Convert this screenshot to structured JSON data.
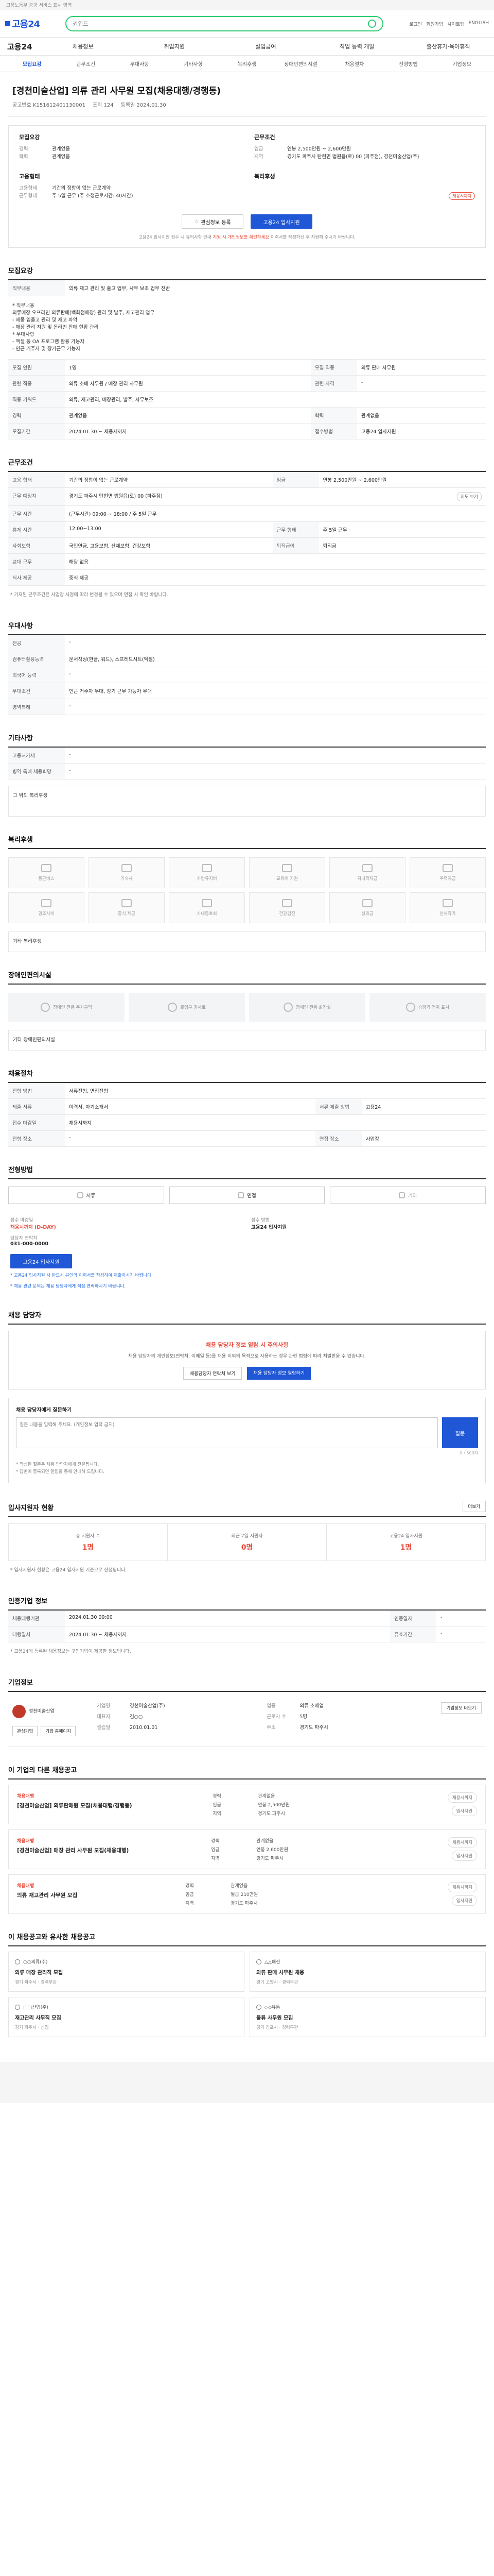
{
  "topbar": {
    "text": "고용노동부 공공 서비스 표시 영역"
  },
  "header": {
    "logo": "고용24",
    "search_placeholder": "키워드",
    "links": [
      "로그인",
      "회원가입",
      "사이트맵",
      "ENGLISH"
    ]
  },
  "nav": {
    "brand": "고용24",
    "items": [
      "채용정보",
      "취업지원",
      "실업급여",
      "직업 능력 개발",
      "출산휴가·육아휴직"
    ]
  },
  "tabs": {
    "items": [
      "모집요강",
      "근무조건",
      "우대사항",
      "기타사항",
      "복리후생",
      "장애인편의시설",
      "채용절차",
      "전형방법",
      "기업정보"
    ],
    "active": 0
  },
  "job": {
    "title": "[경천미술산업] 의류 관리 사무원 모집(채용대행/경행동)",
    "meta": [
      "공고번호 K151612401130001",
      "조회 124",
      "등록일 2024.01.30"
    ],
    "summary": {
      "left_title": "모집요강",
      "left": [
        {
          "k": "경력",
          "v": "관계없음"
        },
        {
          "k": "학력",
          "v": "관계없음"
        }
      ],
      "right_title": "근무조건",
      "right": [
        {
          "k": "임금",
          "v": "연봉 2,500만원 ~ 2,600만원"
        },
        {
          "k": "지역",
          "v": "경기도 파주시 탄현면 법원읍(로) 00 (파주점), 경천미술산업(주)"
        }
      ],
      "left2_title": "고용형태",
      "left2": [
        {
          "k": "고용형태",
          "v": "기간의 정함이 없는 근로계약"
        },
        {
          "k": "근무형태",
          "v": "주 5일 근무 (주 소정근로시간: 40시간)"
        }
      ],
      "right2_title": "복리후생",
      "right2": [],
      "deadline_badge": "채용시까지"
    },
    "buttons": {
      "save": "관심정보 등록",
      "apply": "고용24 입사지원"
    },
    "apply_notice_pre": "고용24 입사지원 접수 시 유의사항 안내",
    "apply_notice_red": "지원 시 개인정보를 확인하세요",
    "apply_notice_post": "이력서를 작성하신 후 지원해 주시기 바랍니다."
  },
  "recruit": {
    "title": "모집요강",
    "rows": [
      {
        "k": "직무내용",
        "v": "의류 재고 관리 및 출고 업무, 사무 보조 업무 전반"
      }
    ],
    "desc": [
      "* 직무내용",
      "의류매장 오프라인 의류판매(백화점매장) 관리 및 발주, 재고관리 업무",
      "- 제품 입출고 관리 및 재고 파악",
      "- 매장 관리 지원 및 온라인 판매 현황 관리",
      "* 우대사항",
      "- 엑셀 등 OA 프로그램 활용 가능자",
      "- 인근 거주자 및 장기근무 가능자"
    ],
    "table": [
      {
        "k1": "모집 인원",
        "v1": "1명",
        "k2": "모집 직종",
        "v2": "의류 판매 사무원"
      },
      {
        "k1": "관련 직종",
        "v1": "의류 소매 사무원 / 매장 관리 사무원",
        "k2": "관련 자격",
        "v2": "-"
      },
      {
        "k1": "직종 키워드",
        "v1": "의류, 재고관리, 매장관리, 발주, 사무보조",
        "k2": "",
        "v2": ""
      },
      {
        "k1": "경력",
        "v1": "관계없음",
        "k2": "학력",
        "v2": "관계없음"
      },
      {
        "k1": "모집기간",
        "v1": "2024.01.30 ~ 채용시까지",
        "k2": "접수방법",
        "v2": "고용24 입사지원"
      }
    ]
  },
  "condition": {
    "title": "근무조건",
    "rows": [
      {
        "k": "고용 형태",
        "v": "기간의 정함이 없는 근로계약",
        "k2": "임금",
        "v2": "연봉 2,500만원 ~ 2,600만원"
      },
      {
        "k": "근무 예정지",
        "v": "경기도 파주시 탄현면 법원읍(로) 00 (파주점)",
        "k2": "",
        "v2": ""
      },
      {
        "k": "근무 시간",
        "v": "(근무시간) 09:00 ~ 18:00 / 주 5일 근무",
        "k2": "",
        "v2": ""
      },
      {
        "k": "휴게 시간",
        "v": "12:00~13:00",
        "k2": "근무 형태",
        "v2": "주 5일 근무"
      },
      {
        "k": "사회보험",
        "v": "국민연금, 고용보험, 산재보험, 건강보험",
        "k2": "퇴직급여",
        "v2": "퇴직금"
      },
      {
        "k": "교대 근무",
        "v": "해당 없음",
        "k2": "",
        "v2": ""
      },
      {
        "k": "식사 제공",
        "v": "중식 제공",
        "k2": "",
        "v2": ""
      }
    ],
    "map_button": "지도 보기",
    "note": "* 기재된 근무조건은 사업장 사정에 따라 변경될 수 있으며 면접 시 확인 바랍니다."
  },
  "prefer": {
    "title": "우대사항",
    "rows": [
      {
        "k": "전공",
        "v": "-"
      },
      {
        "k": "컴퓨터활용능력",
        "v": "문서작성(한글, 워드), 스프레드시트(엑셀)"
      },
      {
        "k": "외국어 능력",
        "v": "-"
      },
      {
        "k": "우대조건",
        "v": "인근 거주자 우대, 장기 근무 가능자 우대"
      },
      {
        "k": "병역특례",
        "v": "-"
      }
    ]
  },
  "etc": {
    "title": "기타사항",
    "rows": [
      {
        "k": "고용허가제",
        "v": "-"
      },
      {
        "k": "병역 특례 채용희망",
        "v": "-"
      }
    ],
    "box": "그 밖의 복리후생"
  },
  "welfare": {
    "title": "복리후생",
    "items": [
      "통근버스",
      "기숙사",
      "차량유지비",
      "교육비 지원",
      "자녀학자금",
      "주택자금",
      "경조사비",
      "중식 제공",
      "사내동호회",
      "건강검진",
      "성과급",
      "연차휴가"
    ],
    "other_label": "기타 복리후생"
  },
  "facility": {
    "title": "장애인편의시설",
    "items": [
      "장애인 전용 주차구역",
      "출입구 경사로",
      "장애인 전용 화장실",
      "승강기 점자 표시"
    ],
    "other_label": "기타 장애인편의시설"
  },
  "process": {
    "title": "채용절차",
    "rows": [
      {
        "k": "전형 방법",
        "v": "서류전형, 면접전형",
        "k2": "",
        "v2": ""
      },
      {
        "k": "제출 서류",
        "v": "이력서, 자기소개서",
        "k2": "서류 제출 방법",
        "v2": "고용24"
      },
      {
        "k": "접수 마감일",
        "v": "채용시까지",
        "k2": "",
        "v2": ""
      },
      {
        "k": "전형 장소",
        "v": "-",
        "k2": "면접 장소",
        "v2": "사업장"
      }
    ]
  },
  "method": {
    "title": "전형방법",
    "types": [
      "서류",
      "면접",
      "기타"
    ],
    "contact_label_1": "접수 마감일",
    "contact_value_1": "채용시까지 (D-DAY)",
    "contact_label_2": "접수 방법",
    "contact_value_2": "고용24 입사지원",
    "contact_label_3": "담당자 연락처",
    "contact_value_3": "031-000-0000",
    "apply_btn": "고용24 입사지원",
    "notes": [
      "* 고용24 입사지원 시 반드시 본인의 이력서를 작성하여 제출하시기 바랍니다.",
      "* 채용 관련 문의는 채용 담당자에게 직접 연락하시기 바랍니다."
    ]
  },
  "inquiry": {
    "title": "채용 담당자",
    "warning_title": "채용 담당자 정보 열람 시 주의사항",
    "warning_text": "채용 담당자의 개인정보(연락처, 이메일 등)를 채용 이외의 목적으로 사용하는 경우 관련 법령에 따라 처벌받을 수 있습니다.",
    "warning_btn1": "채용담당자 연락처 보기",
    "warning_btn2": "채용 담당자 정보 열람하기",
    "ask_title": "채용 담당자에게 질문하기",
    "ask_placeholder": "질문 내용을 입력해 주세요. (개인정보 입력 금지)",
    "ask_btn": "질문",
    "ask_counter": "0 / 500자",
    "ask_notes": [
      "* 작성된 질문은 채용 담당자에게 전달됩니다.",
      "* 답변이 등록되면 알림을 통해 안내해 드립니다."
    ]
  },
  "applicants": {
    "title": "입사지원자 현황",
    "more": "더보기",
    "stats": [
      {
        "label": "총 지원자 수",
        "value": "1명"
      },
      {
        "label": "최근 7일 지원자",
        "value": "0명"
      },
      {
        "label": "고용24 입사지원",
        "value": "1명"
      }
    ],
    "note": "* 입사지원자 현황은 고용24 입사지원 기준으로 산정됩니다."
  },
  "history": {
    "title": "인증기업 정보",
    "rows": [
      {
        "k": "채용대행기관",
        "v": "2024.01.30 09:00",
        "k2": "인증일자",
        "v2": "-"
      },
      {
        "k": "대행일시",
        "v": "2024.01.30 ~ 채용시까지",
        "k2": "유효기간",
        "v2": "-"
      }
    ],
    "note": "* 고용24에 등록된 채용정보는 구인기업이 제공한 정보입니다."
  },
  "company": {
    "title": "기업정보",
    "name": "경천미술산업(주)",
    "logo_text": "경천미술산업",
    "info": [
      {
        "k": "기업명",
        "v": "경천미술산업(주)"
      },
      {
        "k": "업종",
        "v": "의류 소매업"
      },
      {
        "k": "대표자",
        "v": "김○○"
      },
      {
        "k": "근로자 수",
        "v": "5명"
      },
      {
        "k": "설립일",
        "v": "2010.01.01"
      },
      {
        "k": "주소",
        "v": "경기도 파주시"
      }
    ],
    "actions": [
      "관심기업",
      "기업 홈페이지"
    ],
    "more_btn": "기업정보 더보기"
  },
  "other_jobs": {
    "title": "이 기업의 다른 채용공고",
    "items": [
      {
        "corp": "채용대행",
        "title": "[경천미술산업] 의류판매원 모집(채용대행/경행동)",
        "detail": [
          {
            "k": "경력",
            "v": "관계없음"
          },
          {
            "k": "임금",
            "v": "연봉 2,500만원"
          },
          {
            "k": "지역",
            "v": "경기도 파주시"
          }
        ],
        "side": [
          "채용시까지",
          "입사지원"
        ]
      },
      {
        "corp": "채용대행",
        "title": "[경천미술산업] 매장 관리 사무원 모집(채용대행)",
        "detail": [
          {
            "k": "경력",
            "v": "관계없음"
          },
          {
            "k": "임금",
            "v": "연봉 2,600만원"
          },
          {
            "k": "지역",
            "v": "경기도 파주시"
          }
        ],
        "side": [
          "채용시까지",
          "입사지원"
        ]
      },
      {
        "corp": "채용대행",
        "title": "의류 재고관리 사무원 모집",
        "detail": [
          {
            "k": "경력",
            "v": "관계없음"
          },
          {
            "k": "임금",
            "v": "월급 210만원"
          },
          {
            "k": "지역",
            "v": "경기도 파주시"
          }
        ],
        "side": [
          "채용시까지",
          "입사지원"
        ]
      }
    ]
  },
  "recommend": {
    "title": "이 채용공고와 유사한 채용공고",
    "items": [
      {
        "corp": "○○의류(주)",
        "title": "의류 매장 관리직 모집",
        "meta": "경기 파주시 · 경력무관"
      },
      {
        "corp": "△△패션",
        "title": "의류 판매 사무원 채용",
        "meta": "경기 고양시 · 경력무관"
      },
      {
        "corp": "□□산업(주)",
        "title": "재고관리 사무직 모집",
        "meta": "경기 파주시 · 신입"
      },
      {
        "corp": "◇◇유통",
        "title": "물류 사무원 모집",
        "meta": "경기 김포시 · 경력무관"
      }
    ]
  }
}
